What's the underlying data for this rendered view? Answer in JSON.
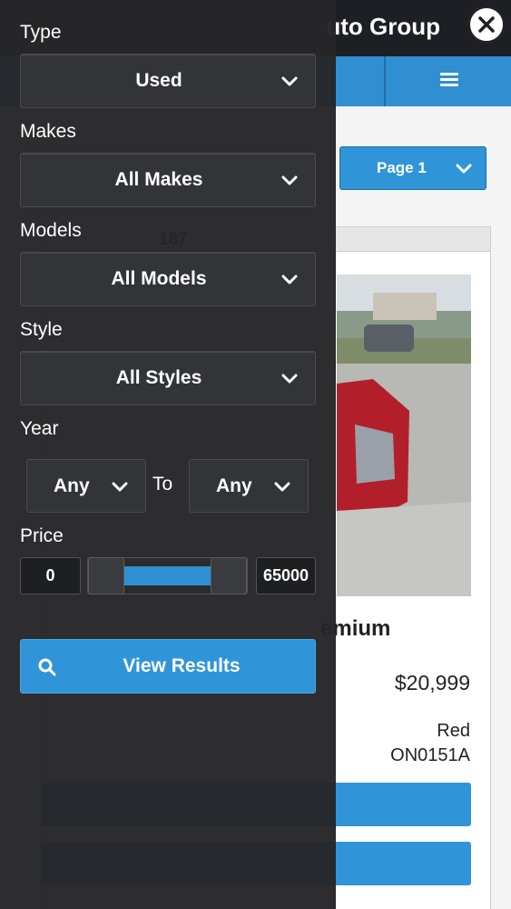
{
  "header": {
    "title": "uto Group"
  },
  "navigation": {
    "menu_icon": "hamburger-icon"
  },
  "pager": {
    "label": "Page 1"
  },
  "listing": {
    "header_text": "187",
    "title": "emium",
    "price": "$20,999",
    "color": "Red",
    "stock": "ON0151A"
  },
  "filters": {
    "type": {
      "label": "Type",
      "value": "Used"
    },
    "makes": {
      "label": "Makes",
      "value": "All Makes"
    },
    "models": {
      "label": "Models",
      "value": "All Models"
    },
    "style": {
      "label": "Style",
      "value": "All Styles"
    },
    "year": {
      "label": "Year",
      "from": "Any",
      "to_label": "To",
      "to": "Any"
    },
    "price": {
      "label": "Price",
      "min": "0",
      "max": "65000",
      "range_min": 0,
      "range_max": 65000,
      "selected_min": 0,
      "selected_max": 65000
    },
    "submit_label": "View Results"
  },
  "colors": {
    "accent": "#2f95d8",
    "drawer": "#262628",
    "control": "#333437"
  }
}
